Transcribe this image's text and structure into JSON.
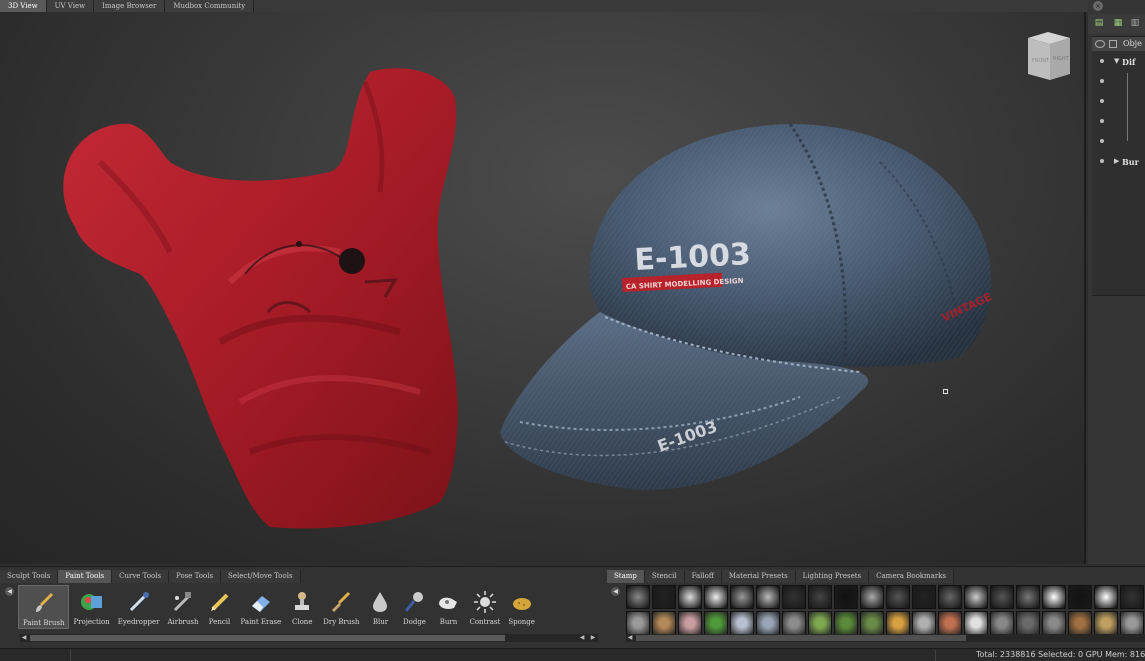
{
  "top_tabs": [
    "3D View",
    "UV View",
    "Image Browser",
    "Mudbox Community"
  ],
  "viewport": {
    "viewcube_faces": [
      "FRONT",
      "RIGHT"
    ],
    "cap_text": {
      "logo": "E-1003",
      "band": "CA SHIRT MODELLING DESIGN",
      "side": "VINTAGE",
      "brim": "E-1003"
    }
  },
  "right_panel": {
    "header_label": "Obje",
    "rows": [
      {
        "label": "Dif",
        "expanded": true
      },
      {
        "label": "Bur",
        "expanded": false
      }
    ]
  },
  "tool_tabs": [
    "Sculpt Tools",
    "Paint Tools",
    "Curve Tools",
    "Pose Tools",
    "Select/Move Tools"
  ],
  "active_tool_tab": "Paint Tools",
  "stamp_tabs": [
    "Stamp",
    "Stencil",
    "Falloff",
    "Material Presets",
    "Lighting Presets",
    "Camera Bookmarks"
  ],
  "active_stamp_tab": "Stamp",
  "tools": [
    {
      "label": "Paint Brush",
      "icon": "paint-brush-icon",
      "selected": true
    },
    {
      "label": "Projection",
      "icon": "projection-icon"
    },
    {
      "label": "Eyedropper",
      "icon": "eyedropper-icon"
    },
    {
      "label": "Airbrush",
      "icon": "airbrush-icon"
    },
    {
      "label": "Pencil",
      "icon": "pencil-icon"
    },
    {
      "label": "Paint Erase",
      "icon": "eraser-icon"
    },
    {
      "label": "Clone",
      "icon": "clone-stamp-icon"
    },
    {
      "label": "Dry Brush",
      "icon": "dry-brush-icon"
    },
    {
      "label": "Blur",
      "icon": "blur-drop-icon"
    },
    {
      "label": "Dodge",
      "icon": "dodge-icon"
    },
    {
      "label": "Burn",
      "icon": "burn-icon"
    },
    {
      "label": "Contrast",
      "icon": "contrast-icon"
    },
    {
      "label": "Sponge",
      "icon": "sponge-icon"
    }
  ],
  "status": {
    "text": "Total: 2338816  Selected: 0 GPU Mem: 816"
  },
  "colors": {
    "shirt_red": "#b01e2a",
    "cap_denim": "#4a5d76",
    "accent_red": "#c0282c"
  }
}
